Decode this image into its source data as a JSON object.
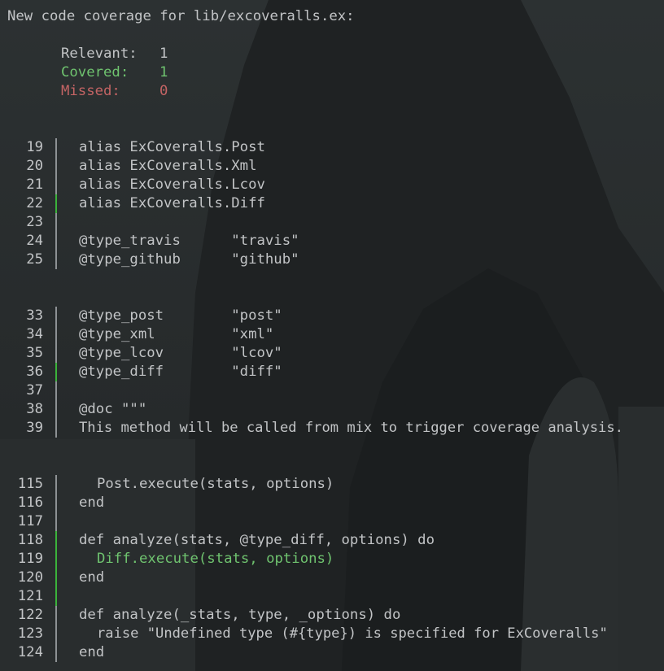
{
  "header": "New code coverage for lib/excoveralls.ex:",
  "stats": {
    "relevant_label": "Relevant:",
    "relevant_value": "1",
    "covered_label": "Covered:",
    "covered_value": "1",
    "missed_label": "Missed:",
    "missed_value": "0"
  },
  "lines": [
    {
      "num": "19",
      "code": "alias ExCoveralls.Post"
    },
    {
      "num": "20",
      "code": "alias ExCoveralls.Xml"
    },
    {
      "num": "21",
      "code": "alias ExCoveralls.Lcov"
    },
    {
      "num": "22",
      "code": "alias ExCoveralls.Diff"
    },
    {
      "num": "23",
      "code": ""
    },
    {
      "num": "24",
      "code": "@type_travis      \"travis\""
    },
    {
      "num": "25",
      "code": "@type_github      \"github\""
    },
    {
      "num": "33",
      "code": "@type_post        \"post\""
    },
    {
      "num": "34",
      "code": "@type_xml         \"xml\""
    },
    {
      "num": "35",
      "code": "@type_lcov        \"lcov\""
    },
    {
      "num": "36",
      "code": "@type_diff        \"diff\""
    },
    {
      "num": "37",
      "code": ""
    },
    {
      "num": "38",
      "code": "@doc \"\"\""
    },
    {
      "num": "39",
      "code": "This method will be called from mix to trigger coverage analysis."
    },
    {
      "num": "115",
      "code": "Post.execute(stats, options)"
    },
    {
      "num": "116",
      "code": "end"
    },
    {
      "num": "117",
      "code": ""
    },
    {
      "num": "118",
      "code": "def analyze(stats, @type_diff, options) do"
    },
    {
      "num": "119",
      "code": "Diff.execute(stats, options)"
    },
    {
      "num": "120",
      "code": "end"
    },
    {
      "num": "121",
      "code": ""
    },
    {
      "num": "122",
      "code": "def analyze(_stats, type, _options) do"
    },
    {
      "num": "123",
      "code": "raise \"Undefined type (#{type}) is specified for ExCoveralls\""
    },
    {
      "num": "124",
      "code": "end"
    }
  ],
  "colors": {
    "background": "#262a2b",
    "text": "#c2c4c6",
    "covered": "#6fc36f",
    "missed": "#c46464",
    "covered_bar": "#3bb33b",
    "gutter_bar": "#8d9194"
  }
}
